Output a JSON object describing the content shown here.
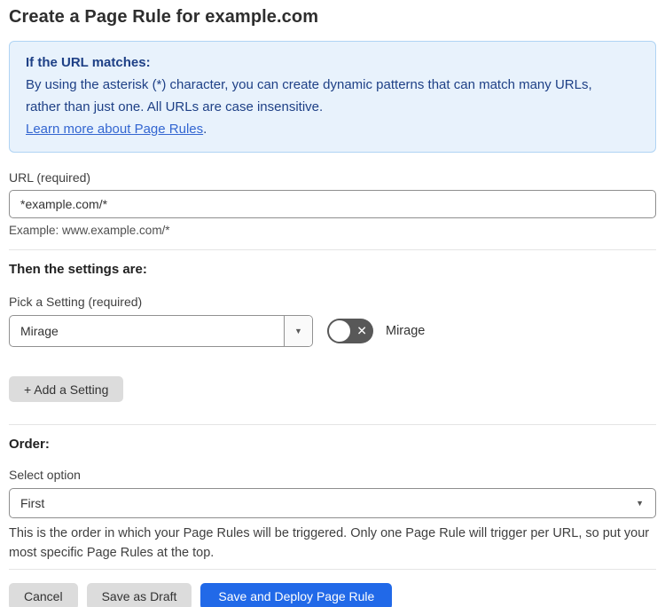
{
  "page": {
    "title": "Create a Page Rule for example.com"
  },
  "info_box": {
    "heading": "If the URL matches:",
    "body": "By using the asterisk (*) character, you can create dynamic patterns that can match many URLs, rather than just one. All URLs are case insensitive.",
    "link_label": "Learn more about Page Rules",
    "link_suffix": "."
  },
  "url_field": {
    "label": "URL (required)",
    "value": "*example.com/*",
    "helper": "Example: www.example.com/*"
  },
  "settings_section": {
    "heading": "Then the settings are:",
    "picker_label": "Pick a Setting (required)",
    "selected_setting": "Mirage",
    "toggle_label": "Mirage",
    "toggle_state": "off",
    "add_button_label": "+ Add a Setting"
  },
  "order_section": {
    "heading": "Order:",
    "label": "Select option",
    "selected_option": "First",
    "helper": "This is the order in which your Page Rules will be triggered. Only one Page Rule will trigger per URL, so put your most specific Page Rules at the top."
  },
  "footer": {
    "cancel_label": "Cancel",
    "save_draft_label": "Save as Draft",
    "save_deploy_label": "Save and Deploy Page Rule"
  },
  "icons": {
    "dropdown_arrow": "▼",
    "toggle_off_glyph": "✕"
  },
  "colors": {
    "info_bg": "#e8f2fc",
    "info_border": "#b0d4f4",
    "info_text": "#1e4086",
    "link": "#3366d1",
    "primary_button": "#2169e8",
    "toggle_off": "#585858",
    "secondary_button": "#dcdcdc",
    "divider": "#e4e4e4"
  }
}
